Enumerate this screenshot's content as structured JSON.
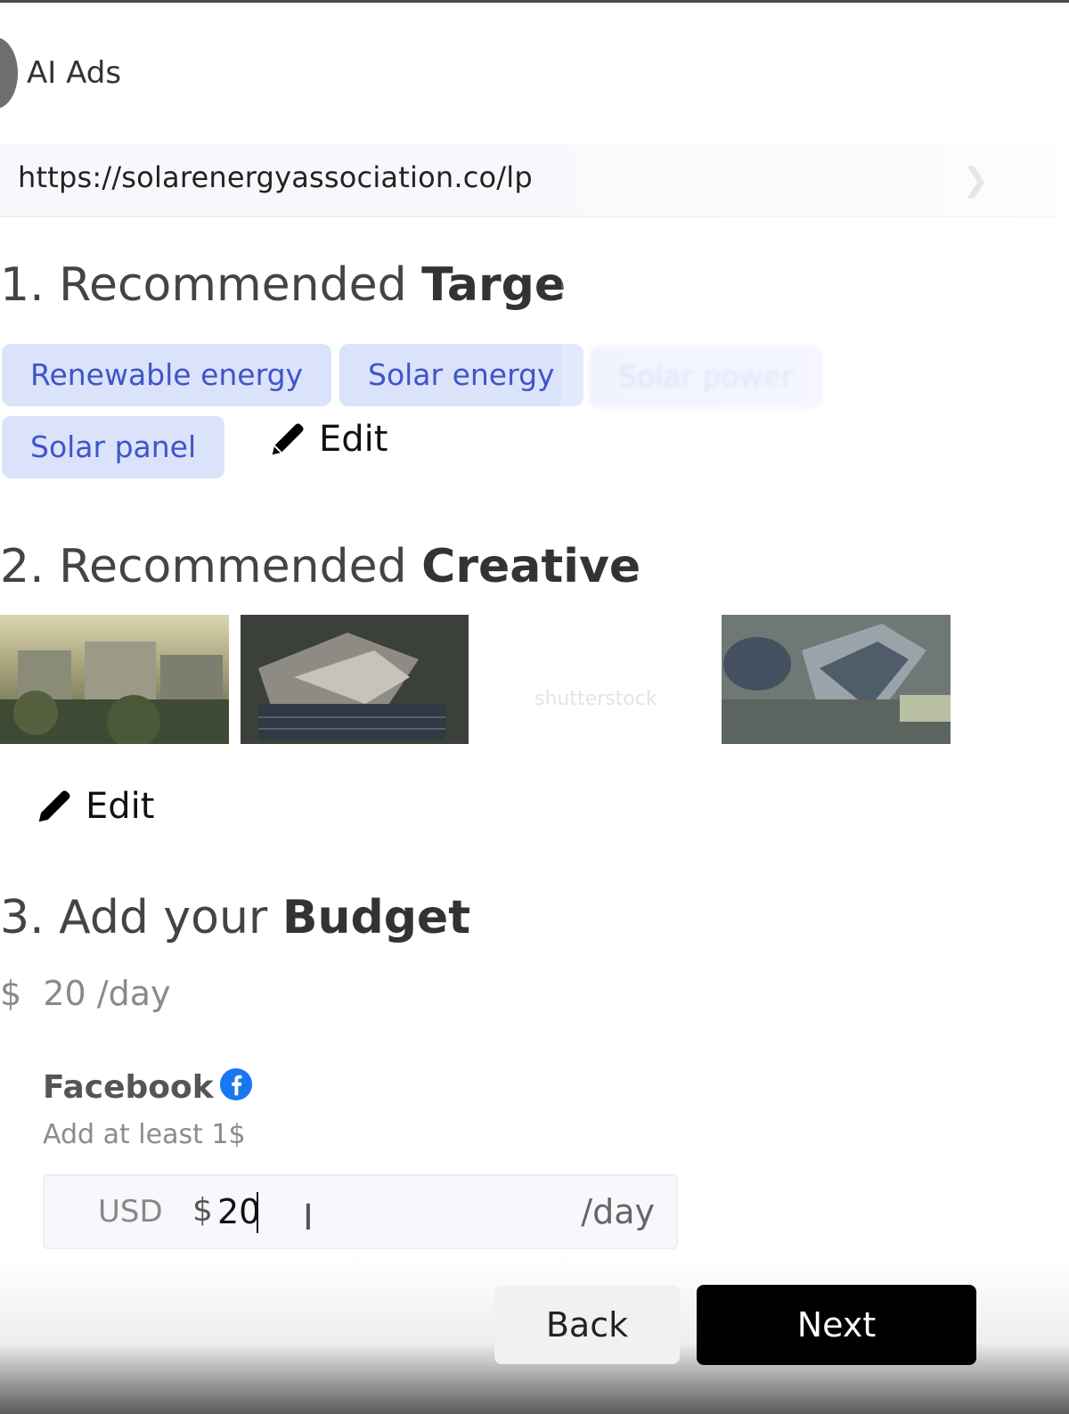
{
  "header": {
    "title": "AI Ads"
  },
  "url_bar": {
    "value": "https://solarenergyassociation.co/lp"
  },
  "targeting": {
    "number": "1.",
    "title_prefix": "Recommended",
    "title_bold": "Targe",
    "chips": [
      "Renewable energy",
      "Solar energy",
      "Solar power",
      "Solar panel"
    ],
    "edit_label": "Edit"
  },
  "creative": {
    "number": "2.",
    "title_prefix": "Recommended",
    "title_bold": "Creative",
    "watermark": "shutterstock",
    "edit_label": "Edit"
  },
  "budget": {
    "number": "3.",
    "title_prefix": "Add your",
    "title_bold": "Budget",
    "summary_currency": "$",
    "summary_amount": "20",
    "summary_unit": "/day",
    "channel": "Facebook",
    "hint": "Add at least 1$",
    "input_currency": "USD",
    "input_symbol": "$",
    "input_value": "20",
    "input_unit": "/day"
  },
  "actions": {
    "back_label": "Back",
    "next_label": "Next"
  },
  "colors": {
    "chip_bg": "#dbe3fb",
    "chip_text": "#3f55c8",
    "facebook_blue": "#1877f2",
    "primary": "#000000"
  }
}
